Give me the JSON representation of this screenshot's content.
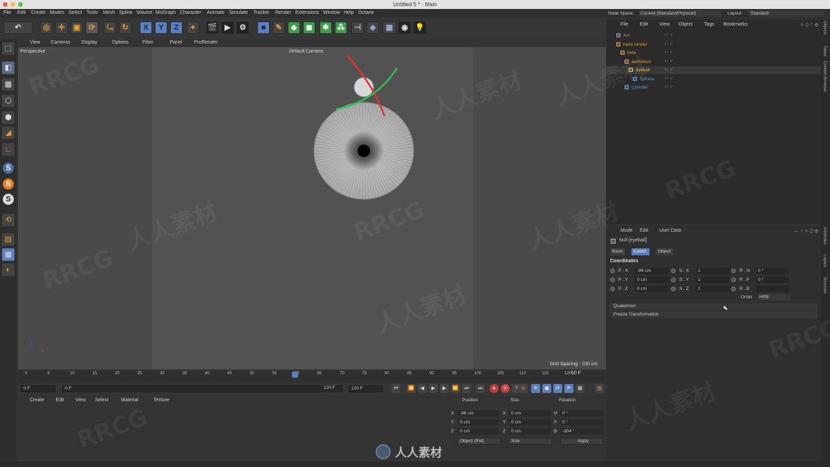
{
  "window": {
    "title": "Untitled 5 * - Main"
  },
  "menu": [
    "File",
    "Edit",
    "Create",
    "Modes",
    "Select",
    "Tools",
    "Mesh",
    "Spline",
    "Volume",
    "MoGraph",
    "Character",
    "Animate",
    "Simulate",
    "Tracker",
    "Render",
    "Extensions",
    "Window",
    "Help",
    "Octane"
  ],
  "node_space": {
    "label": "Node Space:",
    "value": "Current (Standard/Physical)"
  },
  "layout": {
    "label": "Layout:",
    "value": "Standard"
  },
  "toolbar": {
    "x": "X",
    "y": "Y",
    "z": "Z"
  },
  "viewport": {
    "menu": [
      "View",
      "Cameras",
      "Display",
      "Options",
      "Filter",
      "Panel",
      "ProRender"
    ],
    "label": "Perspective",
    "camera": "Default Camera",
    "grid_spacing": "Grid Spacing : 100 cm"
  },
  "timeline": {
    "ticks": [
      "0",
      "5",
      "10",
      "15",
      "20",
      "25",
      "30",
      "35",
      "40",
      "45",
      "50",
      "55",
      "60",
      "65",
      "70",
      "75",
      "80",
      "85",
      "90",
      "95",
      "100",
      "105",
      "110",
      "115",
      "120"
    ],
    "current_frame": "60 F",
    "start": "0 F",
    "range_start": "0 F",
    "range_end": "120 F",
    "end": "120 F"
  },
  "material_manager": {
    "menu": [
      "Create",
      "Edit",
      "View",
      "Select",
      "Material",
      "Texture"
    ]
  },
  "coordinates": {
    "headers": {
      "position": "Position",
      "size": "Size",
      "rotation": "Rotation"
    },
    "rows": [
      {
        "axis": "X",
        "pos": "-96 cm",
        "size_axis": "X",
        "size": "0 cm",
        "rot_axis": "H",
        "rot": "0 °"
      },
      {
        "axis": "Y",
        "pos": "0 cm",
        "size_axis": "Y",
        "size": "0 cm",
        "rot_axis": "P",
        "rot": "0 °"
      },
      {
        "axis": "Z",
        "pos": "0 cm",
        "size_axis": "Z",
        "size": "0 cm",
        "rot_axis": "B",
        "rot": "-304 °"
      }
    ],
    "mode": "Object (Rel)",
    "size_mode": "Size",
    "apply": "Apply"
  },
  "object_manager": {
    "menu": [
      "File",
      "Edit",
      "View",
      "Object",
      "Tags",
      "Bookmarks"
    ],
    "objects": [
      {
        "name": "Arc",
        "indent": 0,
        "color": "#9a9a9a"
      },
      {
        "name": "base render",
        "indent": 0,
        "color": "#e69a2c"
      },
      {
        "name": "bola",
        "indent": 1,
        "color": "#e69a2c"
      },
      {
        "name": "animation",
        "indent": 2,
        "color": "#e69a2c"
      },
      {
        "name": "eyeball",
        "indent": 3,
        "color": "#f0c040"
      },
      {
        "name": "Sphere",
        "indent": 4,
        "color": "#5aa0e0"
      },
      {
        "name": "Cylinder",
        "indent": 2,
        "color": "#5aa0e0"
      }
    ]
  },
  "attributes": {
    "menu": [
      "Mode",
      "Edit",
      "User Data"
    ],
    "object_label": "Null [eyeball]",
    "tabs": [
      "Basic",
      "Coord.",
      "Object"
    ],
    "active_tab": "Coord.",
    "section": "Coordinates",
    "rows": [
      {
        "p_lbl": "P . X",
        "p_val": "-96 cm",
        "s_lbl": "S . X",
        "s_val": "1",
        "r_lbl": "R . H",
        "r_val": "0 °"
      },
      {
        "p_lbl": "P . Y",
        "p_val": "0 cm",
        "s_lbl": "S . Y",
        "s_val": "1",
        "r_lbl": "R . P",
        "r_val": "0 °"
      },
      {
        "p_lbl": "P . Z",
        "p_val": "0 cm",
        "s_lbl": "S . Z",
        "s_val": "1",
        "r_lbl": "R . B",
        "r_val": ""
      }
    ],
    "order_label": "Order",
    "order_value": "HPB",
    "sections": [
      "Quaternion",
      "Freeze Transformation"
    ]
  },
  "side_tabs": [
    "Objects",
    "Takes",
    "Content Browser",
    "Attributes",
    "Layers",
    "Structure"
  ],
  "watermarks": [
    "RRCG",
    "人人素材"
  ],
  "logo_text": "人人素材"
}
